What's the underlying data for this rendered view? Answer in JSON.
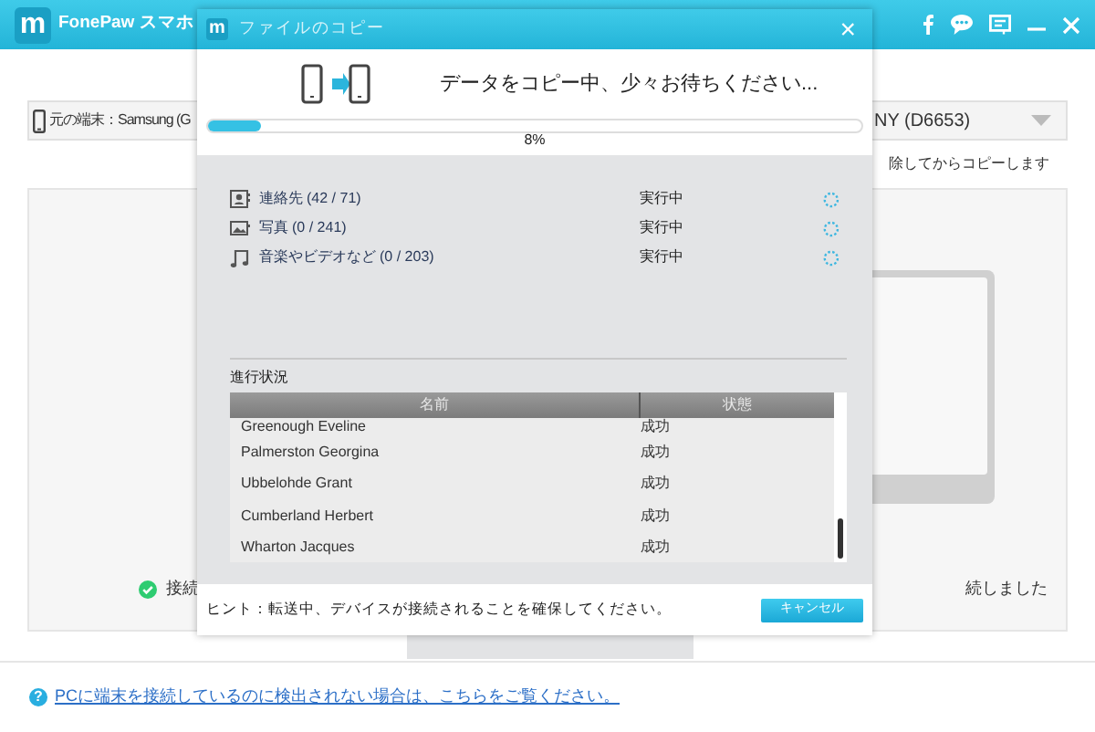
{
  "app": {
    "logo": "m",
    "title": "FonePaw スマホ",
    "source": {
      "label": "元の端末：Samsung (G"
    },
    "target": {
      "label": "NY (D6653)"
    },
    "note": "除してからコピーします",
    "source_status": "接続",
    "target_status": "続しました",
    "help_icon": "?",
    "help_link": "PCに端末を接続しているのに検出されない場合は、こちらをご覧ください。"
  },
  "dialog": {
    "logo": "m",
    "title": "ファイルのコピー",
    "close": "×",
    "message": "データをコピー中、少々お待ちください...",
    "progress": {
      "level": 0.08,
      "reading": "8%"
    },
    "items": [
      {
        "kind": "contacts",
        "label": "連絡先 (42 / 71)",
        "status": "実行中"
      },
      {
        "kind": "photos",
        "label": "写真 (0 / 241)",
        "status": "実行中"
      },
      {
        "kind": "music",
        "label": "音楽やビデオなど (0 / 203)",
        "status": "実行中"
      }
    ],
    "section": "進行状況",
    "columns": [
      "名前",
      "状態"
    ],
    "rows": [
      {
        "name": "Greenough Eveline",
        "status": "成功"
      },
      {
        "name": "Palmerston Georgina",
        "status": "成功"
      },
      {
        "name": "Ubbelohde Grant",
        "status": "成功"
      },
      {
        "name": "Cumberland Herbert",
        "status": "成功"
      },
      {
        "name": "Wharton Jacques",
        "status": "成功"
      }
    ],
    "hint": "ヒント：転送中、デバイスが接続されることを確保してください。",
    "cancel": "キャンセル"
  }
}
